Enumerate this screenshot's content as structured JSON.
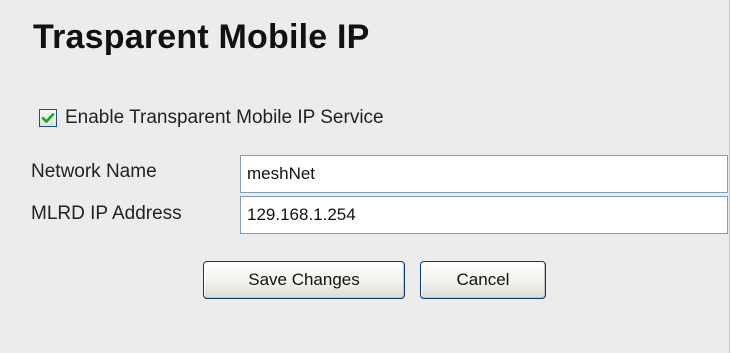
{
  "page": {
    "title": "Trasparent Mobile IP"
  },
  "service": {
    "enable_label": "Enable Transparent Mobile IP Service",
    "enabled": true
  },
  "fields": {
    "network_name": {
      "label": "Network Name",
      "value": "meshNet"
    },
    "mlrd_ip": {
      "label": "MLRD IP Address",
      "value": "129.168.1.254"
    }
  },
  "actions": {
    "save_label": "Save Changes",
    "cancel_label": "Cancel"
  },
  "icons": {
    "checkbox": "checkmark-icon"
  },
  "colors": {
    "background": "#ececec",
    "check_green": "#21a121",
    "button_border": "#003c74",
    "input_border": "#7f9db9"
  }
}
